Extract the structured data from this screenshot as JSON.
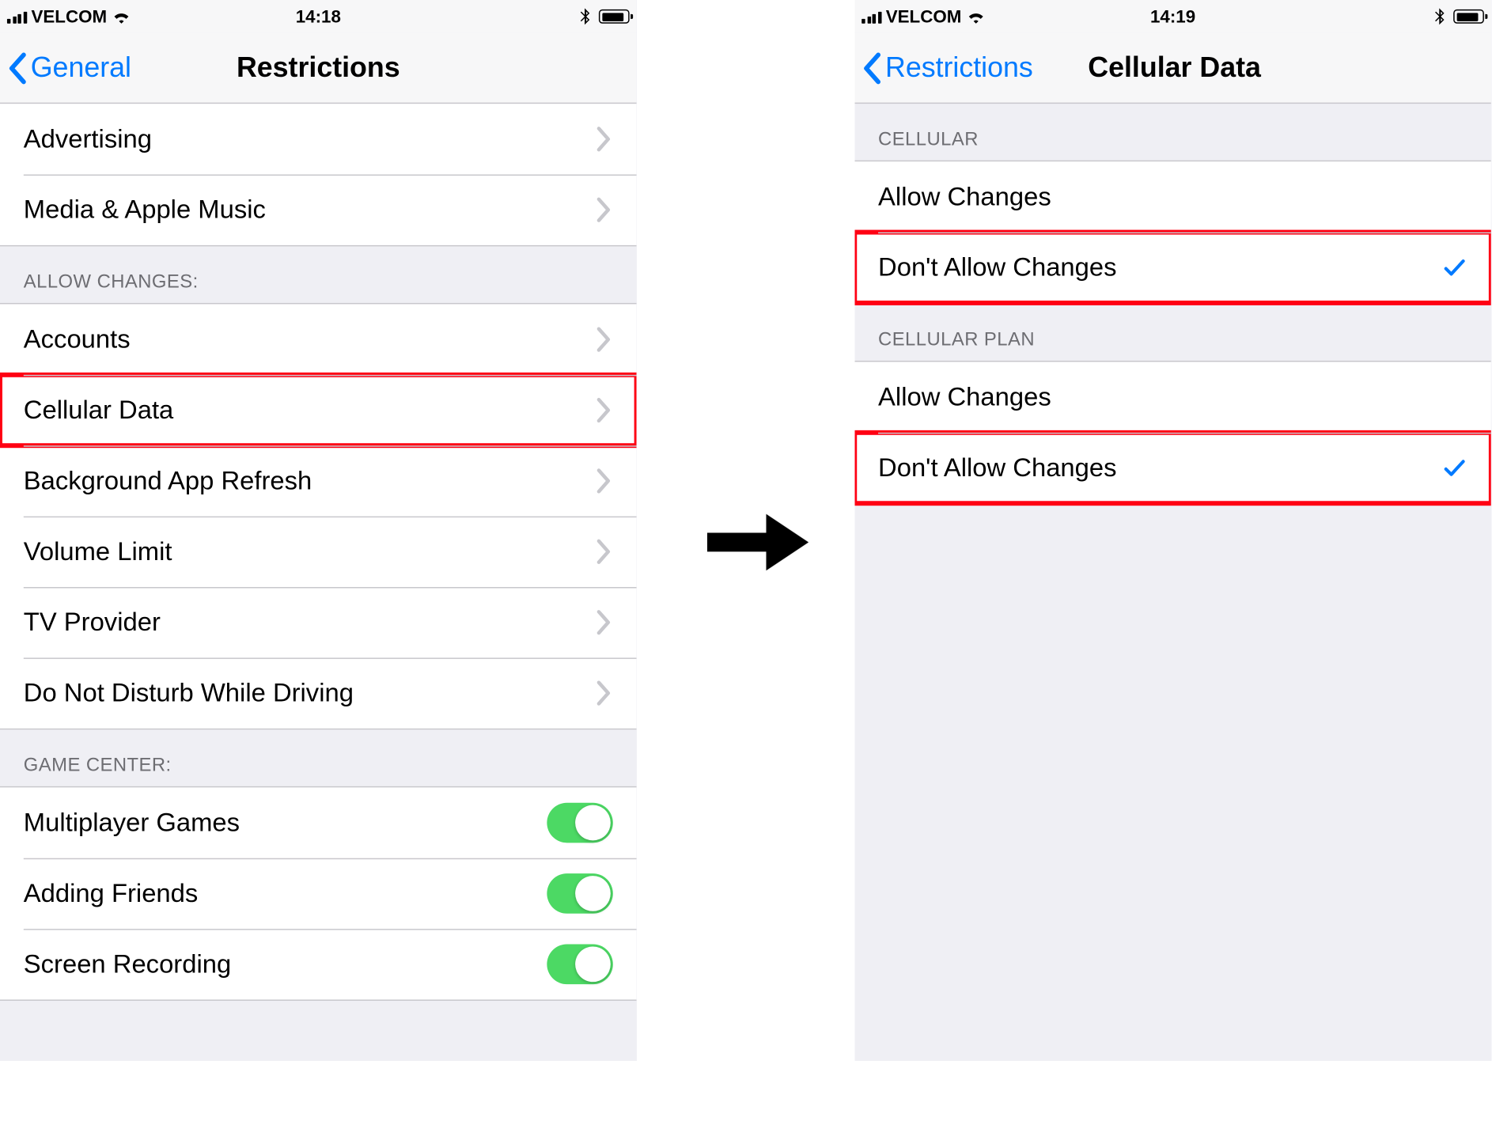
{
  "left": {
    "status": {
      "carrier": "VELCOM",
      "time": "14:18"
    },
    "nav": {
      "back": "General",
      "title": "Restrictions"
    },
    "group_top": [
      {
        "label": "Advertising"
      },
      {
        "label": "Media & Apple Music"
      }
    ],
    "section_allow_header": "ALLOW CHANGES:",
    "group_allow": [
      {
        "label": "Accounts"
      },
      {
        "label": "Cellular Data",
        "highlight": true
      },
      {
        "label": "Background App Refresh"
      },
      {
        "label": "Volume Limit"
      },
      {
        "label": "TV Provider"
      },
      {
        "label": "Do Not Disturb While Driving"
      }
    ],
    "section_gc_header": "GAME CENTER:",
    "group_gc": [
      {
        "label": "Multiplayer Games",
        "toggle": true
      },
      {
        "label": "Adding Friends",
        "toggle": true
      },
      {
        "label": "Screen Recording",
        "toggle": true
      }
    ]
  },
  "right": {
    "status": {
      "carrier": "VELCOM",
      "time": "14:19"
    },
    "nav": {
      "back": "Restrictions",
      "title": "Cellular Data"
    },
    "section_cellular_header": "CELLULAR",
    "group_cellular": [
      {
        "label": "Allow Changes"
      },
      {
        "label": "Don't Allow Changes",
        "checked": true,
        "highlight": true
      }
    ],
    "section_plan_header": "CELLULAR PLAN",
    "group_plan": [
      {
        "label": "Allow Changes"
      },
      {
        "label": "Don't Allow Changes",
        "checked": true,
        "highlight": true
      }
    ]
  }
}
